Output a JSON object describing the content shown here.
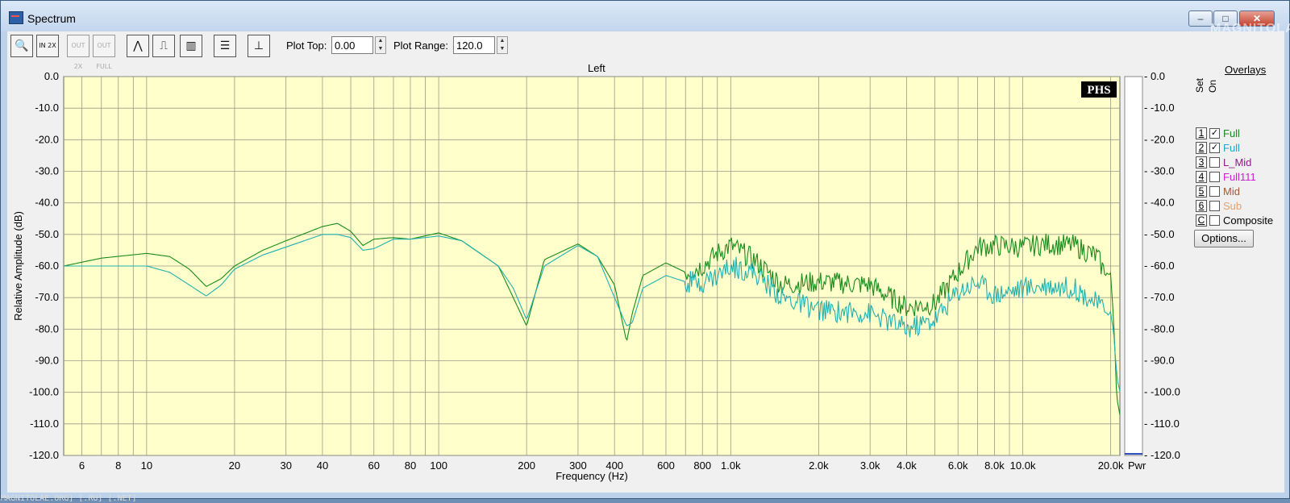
{
  "window": {
    "title": "Spectrum",
    "min_label": "–",
    "max_label": "□",
    "close_label": "✕",
    "watermark": "MAGNITOLA"
  },
  "toolbar": {
    "buttons": [
      {
        "name": "zoom-tool-button",
        "icon": "magnifier-icon",
        "glyph": "🔍",
        "enabled": true
      },
      {
        "name": "zoom-in-2x-button",
        "icon": "zoom-in-icon",
        "glyph": "IN 2X",
        "enabled": true
      },
      {
        "name": "zoom-out-2x-button",
        "icon": "zoom-out-icon",
        "glyph": "OUT 2X",
        "enabled": false
      },
      {
        "name": "zoom-out-full-button",
        "icon": "zoom-full-icon",
        "glyph": "OUT FULL",
        "enabled": false
      },
      {
        "name": "line-plot-button",
        "icon": "line-plot-icon",
        "glyph": "⋀",
        "enabled": true
      },
      {
        "name": "step-plot-button",
        "icon": "step-plot-icon",
        "glyph": "⎍",
        "enabled": true
      },
      {
        "name": "bar-plot-button",
        "icon": "bar-plot-icon",
        "glyph": "▥",
        "enabled": true
      },
      {
        "name": "settings-panel-button",
        "icon": "panel-icon",
        "glyph": "☰",
        "enabled": true
      },
      {
        "name": "vertical-range-button",
        "icon": "vertical-range-icon",
        "glyph": "⊥",
        "enabled": true
      }
    ],
    "plot_top_label": "Plot Top:",
    "plot_top_value": "0.00",
    "plot_range_label": "Plot Range:",
    "plot_range_value": "120.0"
  },
  "chart_data": {
    "type": "line",
    "title": "Left",
    "xlabel": "Frequency (Hz)",
    "ylabel": "Relative Amplitude (dB)",
    "x_scale": "log",
    "xlim": [
      5.2,
      21500
    ],
    "ylim": [
      -120,
      0
    ],
    "grid": true,
    "background": "#ffffcc",
    "x_ticks": [
      {
        "v": 6,
        "label": "6"
      },
      {
        "v": 8,
        "label": "8"
      },
      {
        "v": 10,
        "label": "10"
      },
      {
        "v": 20,
        "label": "20"
      },
      {
        "v": 30,
        "label": "30"
      },
      {
        "v": 40,
        "label": "40"
      },
      {
        "v": 60,
        "label": "60"
      },
      {
        "v": 80,
        "label": "80"
      },
      {
        "v": 100,
        "label": "100"
      },
      {
        "v": 200,
        "label": "200"
      },
      {
        "v": 300,
        "label": "300"
      },
      {
        "v": 400,
        "label": "400"
      },
      {
        "v": 600,
        "label": "600"
      },
      {
        "v": 800,
        "label": "800"
      },
      {
        "v": 1000,
        "label": "1.0k"
      },
      {
        "v": 2000,
        "label": "2.0k"
      },
      {
        "v": 3000,
        "label": "3.0k"
      },
      {
        "v": 4000,
        "label": "4.0k"
      },
      {
        "v": 6000,
        "label": "6.0k"
      },
      {
        "v": 8000,
        "label": "8.0k"
      },
      {
        "v": 10000,
        "label": "10.0k"
      },
      {
        "v": 20000,
        "label": "20.0k"
      }
    ],
    "y_ticks_left": [
      "0.0",
      "-10.0",
      "-20.0",
      "-30.0",
      "-40.0",
      "-50.0",
      "-60.0",
      "-70.0",
      "-80.0",
      "-90.0",
      "-100.0",
      "-110.0",
      "-120.0"
    ],
    "y_ticks_right": [
      "- 0.0",
      "- -10.0",
      "- -20.0",
      "- -30.0",
      "- -40.0",
      "- -50.0",
      "- -60.0",
      "- -70.0",
      "- -80.0",
      "- -90.0",
      "- -100.0",
      "- -110.0",
      "- -120.0"
    ],
    "power_label": "Pwr",
    "logo": "PHS",
    "series": [
      {
        "color": "#1a8a1a",
        "x": [
          5.2,
          7,
          10,
          12,
          14,
          16,
          18,
          20,
          25,
          30,
          40,
          45,
          50,
          55,
          60,
          70,
          80,
          100,
          120,
          160,
          180,
          200,
          230,
          300,
          350,
          400,
          440,
          460,
          500,
          600,
          700,
          800,
          900,
          1000,
          1200,
          1500,
          2000,
          3000,
          4000,
          5000,
          6000,
          7000,
          8000,
          10000,
          12000,
          15000,
          18000,
          19000,
          20000,
          20500,
          21000,
          21500
        ],
        "y": [
          -60,
          -57.5,
          -56,
          -57,
          -61,
          -66.5,
          -64,
          -60,
          -55,
          -52,
          -47.5,
          -46.5,
          -49,
          -53.5,
          -51.5,
          -51,
          -51.5,
          -49.5,
          -52,
          -60,
          -70,
          -79,
          -58,
          -53,
          -57,
          -66,
          -84,
          -75,
          -63,
          -59,
          -62,
          -60,
          -56,
          -53.5,
          -58,
          -66,
          -65,
          -66,
          -73,
          -72,
          -62,
          -54,
          -53.5,
          -54,
          -53,
          -53.5,
          -57,
          -62,
          -63,
          -78,
          -102,
          -108
        ]
      },
      {
        "color": "#20b0b0",
        "x": [
          5.2,
          7,
          10,
          12,
          14,
          16,
          18,
          20,
          25,
          30,
          40,
          45,
          50,
          55,
          60,
          70,
          80,
          100,
          120,
          160,
          180,
          200,
          230,
          300,
          350,
          400,
          440,
          460,
          500,
          600,
          700,
          800,
          900,
          1000,
          1200,
          1500,
          2000,
          3000,
          4000,
          5000,
          6000,
          7000,
          8000,
          10000,
          12000,
          15000,
          18000,
          19000,
          20000,
          20500,
          21000,
          21500
        ],
        "y": [
          -60,
          -60,
          -60,
          -62,
          -66,
          -69.5,
          -66,
          -61,
          -56.5,
          -54,
          -50,
          -50,
          -51,
          -55,
          -54.5,
          -51.5,
          -51.5,
          -50.5,
          -52,
          -60,
          -67,
          -77,
          -60,
          -53.5,
          -57,
          -70,
          -79,
          -78,
          -67,
          -63,
          -65,
          -65,
          -63,
          -60,
          -62,
          -70,
          -74,
          -75,
          -80,
          -77,
          -68,
          -65,
          -69,
          -67,
          -66,
          -67,
          -72,
          -74,
          -75,
          -82,
          -95,
          -100
        ]
      }
    ]
  },
  "overlays": {
    "title": "Overlays",
    "set_label": "Set",
    "on_label": "On",
    "items": [
      {
        "num": "1",
        "checked": true,
        "label": "Full",
        "color": "#1a8a1a"
      },
      {
        "num": "2",
        "checked": true,
        "label": "Full",
        "color": "#20a8c8"
      },
      {
        "num": "3",
        "checked": false,
        "label": "L_Mid",
        "color": "#8a1a8a"
      },
      {
        "num": "4",
        "checked": false,
        "label": "Full111",
        "color": "#cc20cc"
      },
      {
        "num": "5",
        "checked": false,
        "label": "Mid",
        "color": "#9a5a3a"
      },
      {
        "num": "6",
        "checked": false,
        "label": "Sub",
        "color": "#e6a070"
      },
      {
        "num": "C",
        "checked": false,
        "label": "Composite",
        "color": "#000000"
      }
    ],
    "options_label": "Options..."
  },
  "status": {
    "text": "MAGNITOLAE.ORG] [.RU] [.NET]"
  }
}
